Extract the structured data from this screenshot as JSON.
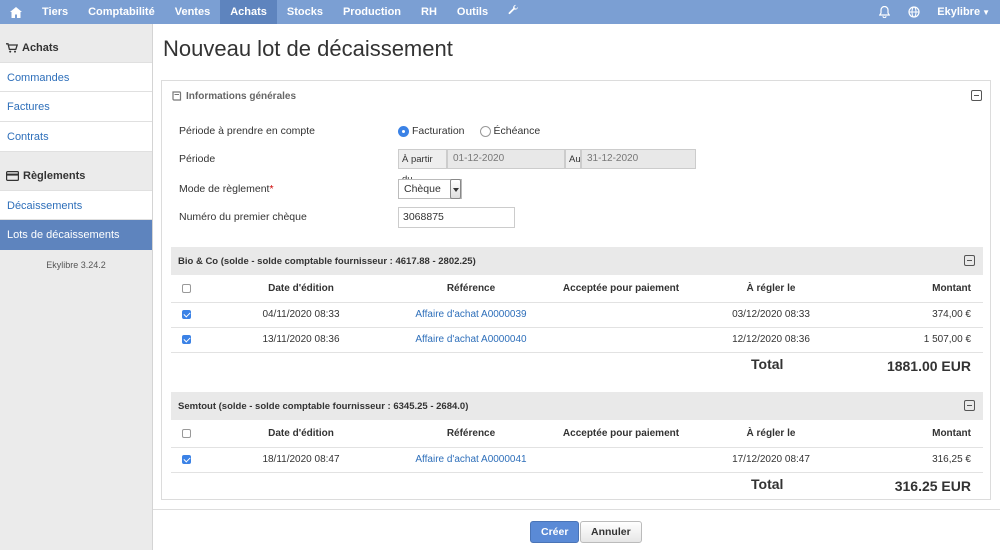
{
  "nav": {
    "items": [
      "Tiers",
      "Comptabilité",
      "Ventes",
      "Achats",
      "Stocks",
      "Production",
      "RH",
      "Outils"
    ],
    "active_index": 3,
    "user": "Ekylibre"
  },
  "sidebar": {
    "section1": "Achats",
    "links1": [
      "Commandes",
      "Factures",
      "Contrats"
    ],
    "section2": "Règlements",
    "links2": [
      "Décaissements",
      "Lots de décaissements"
    ],
    "active_link": "Lots de décaissements",
    "version": "Ekylibre 3.24.2"
  },
  "page": {
    "title": "Nouveau lot de décaissement"
  },
  "general": {
    "header": "Informations générales",
    "period_basis_label": "Période à prendre en compte",
    "radio_billing": "Facturation",
    "radio_due": "Échéance",
    "selected": "Facturation",
    "period_label": "Période",
    "from_label": "À partir du",
    "from_value": "01-12-2020",
    "to_label": "Au",
    "to_value": "31-12-2020",
    "mode_label": "Mode de règlement",
    "mode_required": "*",
    "mode_value": "Chèque",
    "cheque_label": "Numéro du premier chèque",
    "cheque_value": "3068875"
  },
  "columns": {
    "date": "Date d'édition",
    "ref": "Référence",
    "accepted": "Acceptée pour paiement",
    "due": "À régler le",
    "amount": "Montant"
  },
  "groups": [
    {
      "title": "Bio & Co (solde - solde comptable fournisseur : 4617.88 - 2802.25)",
      "rows": [
        {
          "date": "04/11/2020 08:33",
          "ref": "Affaire d'achat A0000039",
          "due": "03/12/2020 08:33",
          "amount": "374,00 €"
        },
        {
          "date": "13/11/2020 08:36",
          "ref": "Affaire d'achat A0000040",
          "due": "12/12/2020 08:36",
          "amount": "1 507,00 €"
        }
      ],
      "total_label": "Total",
      "total": "1881.00 EUR"
    },
    {
      "title": "Semtout (solde - solde comptable fournisseur : 6345.25 - 2684.0)",
      "rows": [
        {
          "date": "18/11/2020 08:47",
          "ref": "Affaire d'achat A0000041",
          "due": "17/12/2020 08:47",
          "amount": "316,25 €"
        }
      ],
      "total_label": "Total",
      "total": "316.25 EUR"
    }
  ],
  "actions": {
    "create": "Créer",
    "cancel": "Annuler"
  }
}
